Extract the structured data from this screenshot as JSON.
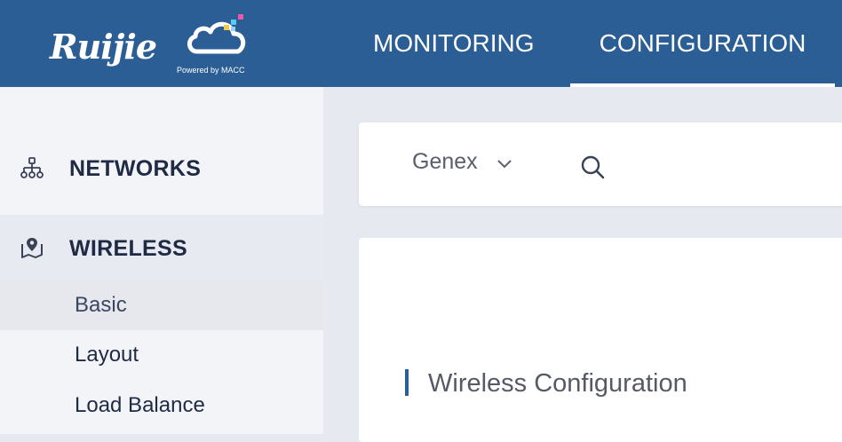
{
  "header": {
    "logo": {
      "brand": "Ruijie",
      "powered_by": "Powered by MACC"
    },
    "tabs": [
      {
        "label": "MONITORING",
        "active": false
      },
      {
        "label": "CONFIGURATION",
        "active": true
      }
    ],
    "background_color": "#2b5e95"
  },
  "sidebar": {
    "sections": [
      {
        "label": "NETWORKS",
        "icon": "network-hierarchy-icon"
      },
      {
        "label": "WIRELESS",
        "icon": "location-pin-icon",
        "expanded": true,
        "items": [
          {
            "label": "Basic",
            "selected": true
          },
          {
            "label": "Layout",
            "selected": false
          },
          {
            "label": "Load Balance",
            "selected": false
          }
        ]
      }
    ]
  },
  "filter_bar": {
    "site_select": {
      "value": "Genex",
      "icon": "chevron-down-icon"
    },
    "search_icon": "search-icon"
  },
  "main": {
    "section_title": "Wireless Configuration",
    "accent_color": "#2b5e95"
  }
}
